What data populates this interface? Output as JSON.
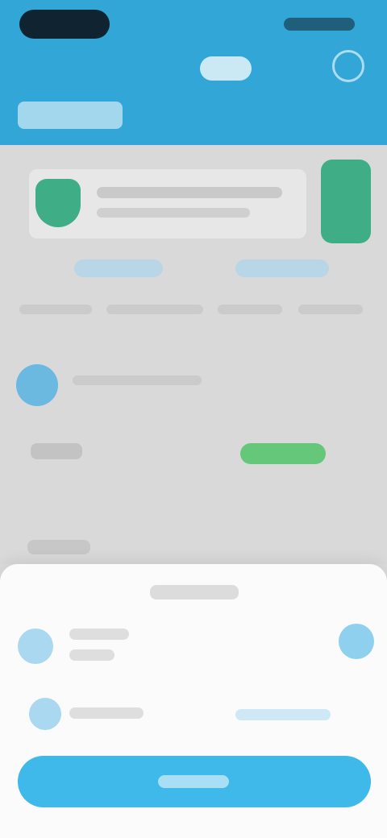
{
  "header": {},
  "banner": {},
  "settings": {},
  "sheet": {
    "options": [
      {},
      {}
    ]
  },
  "colors": {
    "header": "#33a6d8",
    "accent_green": "#3fae87",
    "toggle_on": "#64c77a",
    "cta": "#3fb8ea"
  },
  "icons": [
    "shield-icon",
    "avatar",
    "settings-icon"
  ]
}
